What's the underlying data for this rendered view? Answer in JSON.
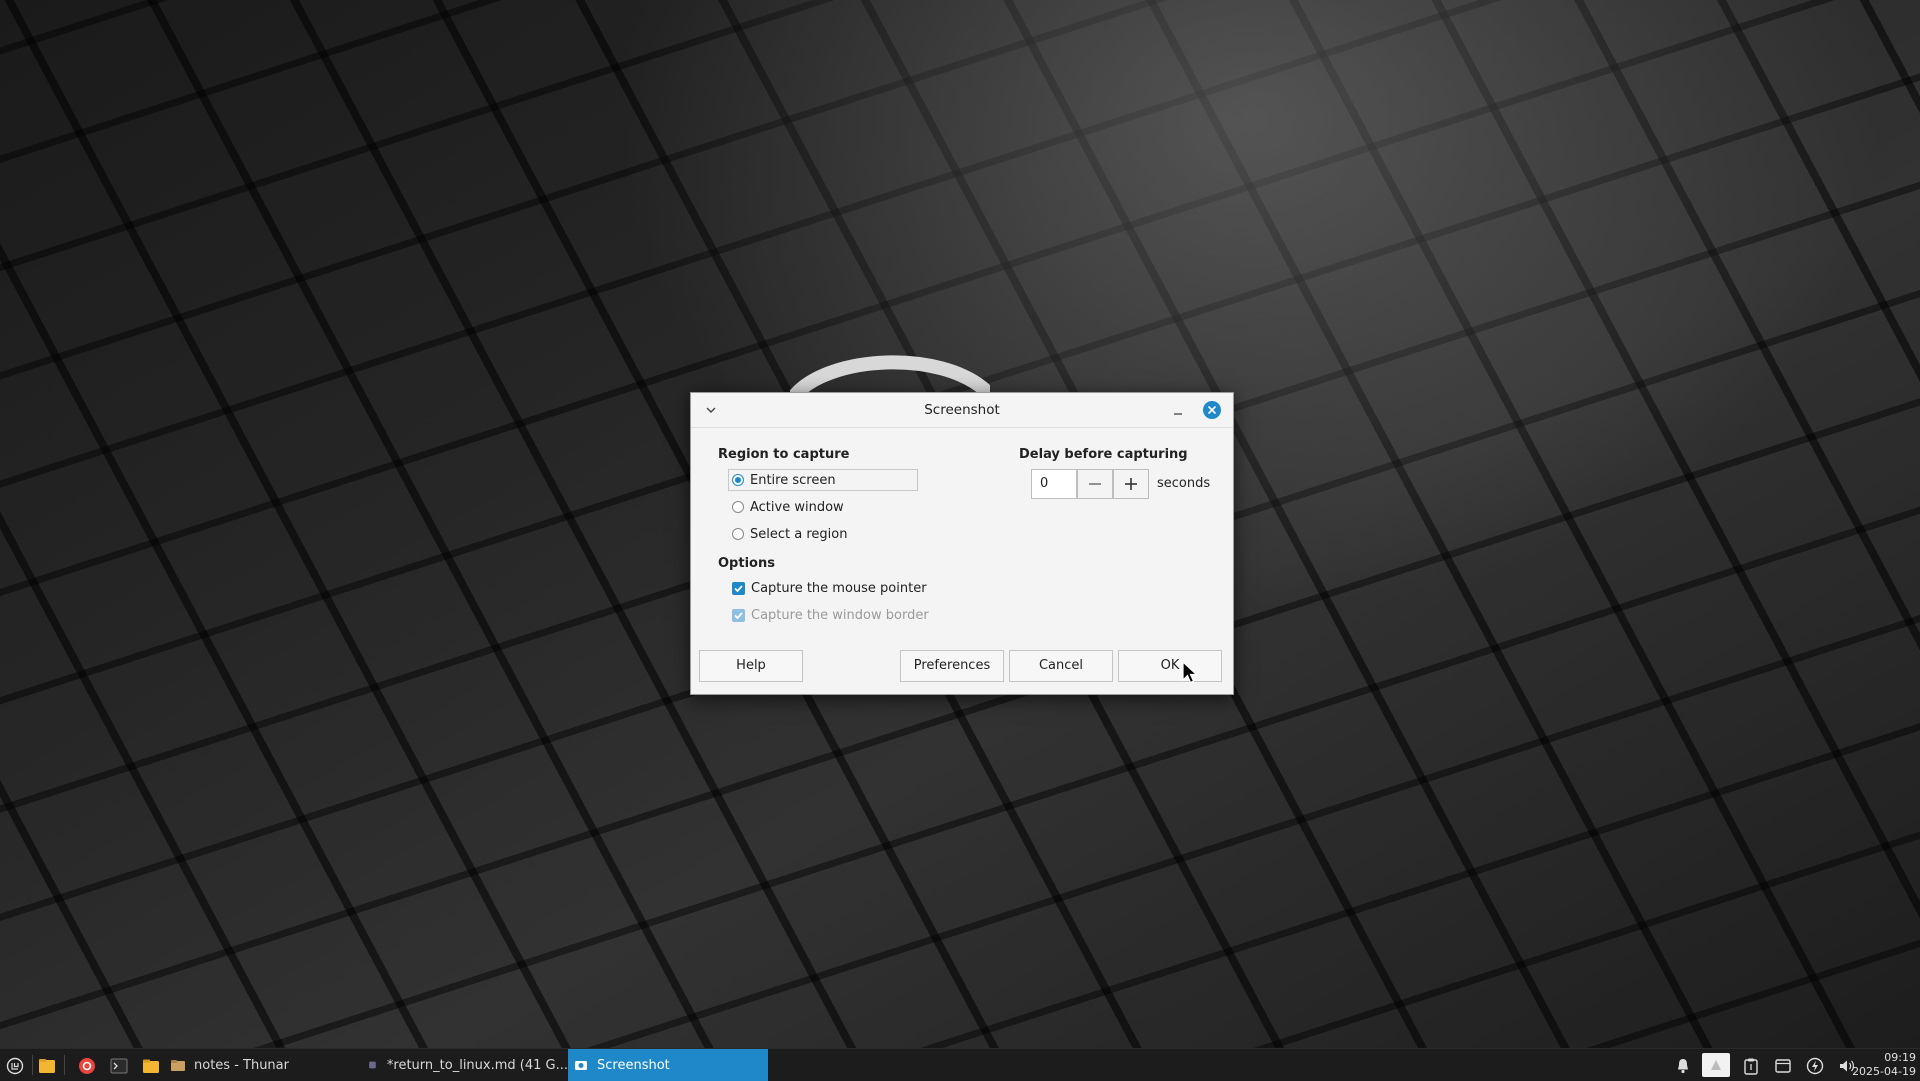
{
  "dialog": {
    "title": "Screenshot",
    "region_label": "Region to capture",
    "region_options": [
      {
        "label": "Entire screen",
        "selected": true
      },
      {
        "label": "Active window",
        "selected": false
      },
      {
        "label": "Select a region",
        "selected": false
      }
    ],
    "options_label": "Options",
    "options": [
      {
        "label": "Capture the mouse pointer",
        "checked": true,
        "enabled": true
      },
      {
        "label": "Capture the window border",
        "checked": true,
        "enabled": false
      }
    ],
    "delay_label": "Delay before capturing",
    "delay_value": "0",
    "delay_unit": "seconds",
    "buttons": {
      "help": "Help",
      "preferences": "Preferences",
      "cancel": "Cancel",
      "ok": "OK"
    }
  },
  "taskbar": {
    "tasks": [
      {
        "label": "notes - Thunar",
        "active": false
      },
      {
        "label": "*return_to_linux.md (41 G...",
        "active": false
      },
      {
        "label": "Screenshot",
        "active": true
      }
    ],
    "clock": {
      "time": "09:19",
      "date": "2025-04-19"
    }
  },
  "colors": {
    "accent": "#1e88c9",
    "taskbar_bg": "#1c1c1c",
    "dialog_bg": "#f4f4f4"
  }
}
